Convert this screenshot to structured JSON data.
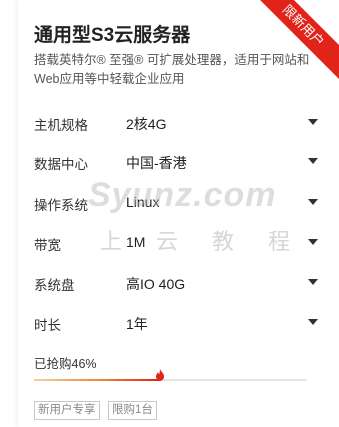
{
  "ribbon": "限新用户",
  "title": "通用型S3云服务器",
  "description": "搭载英特尔® 至强® 可扩展处理器，适用于网站和Web应用等中轻载企业应用",
  "rows": [
    {
      "label": "主机规格",
      "value": "2核4G"
    },
    {
      "label": "数据中心",
      "value": "中国-香港"
    },
    {
      "label": "操作系统",
      "value": "Linux"
    },
    {
      "label": "带宽",
      "value": "1M"
    },
    {
      "label": "系统盘",
      "value": "高IO 40G"
    },
    {
      "label": "时长",
      "value": "1年"
    }
  ],
  "sold": {
    "text": "已抢购46%",
    "percent": 46
  },
  "tags": [
    "新用户专享",
    "限购1台"
  ],
  "watermark": {
    "en": "Syunz.com",
    "cn": "上云教程"
  },
  "colors": {
    "accent": "#e2231a",
    "progress_start": "#f5d0a9",
    "progress_end": "#e2231a"
  },
  "icons": {
    "progress_marker": "flame-icon",
    "dropdown": "caret-down-icon"
  }
}
